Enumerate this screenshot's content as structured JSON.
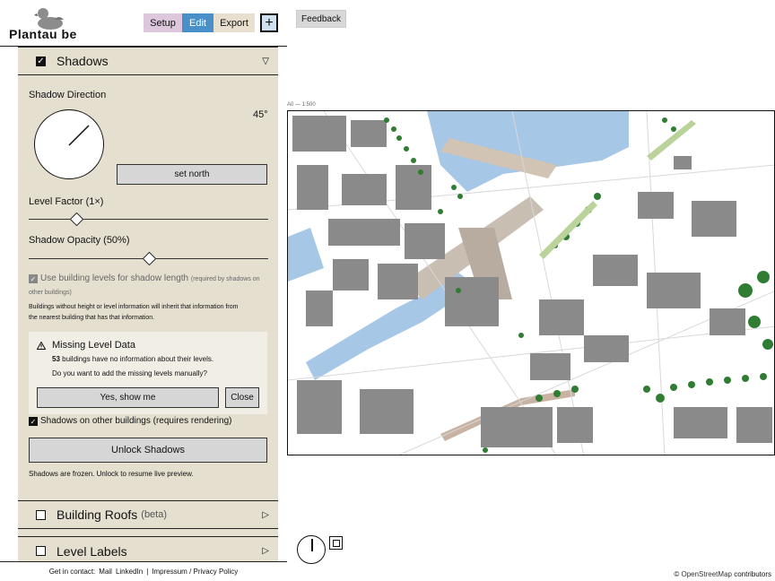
{
  "header": {
    "logo_text": "Plantau be",
    "tabs": [
      {
        "label": "Setup"
      },
      {
        "label": "Edit"
      },
      {
        "label": "Export"
      }
    ],
    "plus_label": "+",
    "feedback_label": "Feedback"
  },
  "shadows": {
    "title": "Shadows",
    "shadow_direction_label": "Shadow Direction",
    "direction_value": "45°",
    "set_north_label": "set north",
    "level_factor_label": "Level Factor (1×)",
    "level_factor_value": 0.2,
    "shadow_opacity_label": "Shadow Opacity (50%)",
    "shadow_opacity_value": 0.5,
    "use_levels_label": "Use building levels for shadow length",
    "use_levels_note": "(required by shadows on",
    "use_levels_note2": "other buildings)",
    "info_line1": "Buildings without height or level information will inherit that information from",
    "info_line2": "the nearest building that has that information.",
    "warning": {
      "title": "Missing Level Data",
      "count": "53",
      "line1_rest": " buildings have no information about their levels.",
      "line2": "Do you want to add the missing levels manually?",
      "yes_label": "Yes, show me",
      "close_label": "Close"
    },
    "other_buildings_label": "Shadows on other buildings (requires rendering)",
    "unlock_label": "Unlock Shadows",
    "frozen_note": "Shadows are frozen. Unlock to resume live preview."
  },
  "sections": [
    {
      "title": "Building Roofs",
      "badge": "(beta)"
    },
    {
      "title": "Level Labels"
    }
  ],
  "footer": {
    "contact": "Get in contact:",
    "mail": "Mail",
    "linkedin": "LinkedIn",
    "sep": "|",
    "impressum": "Impressum / Privacy Policy"
  },
  "map": {
    "scale_label": "A0 — 1:500",
    "attribution_prefix": "© ",
    "attribution_link": "OpenStreetMap",
    "attribution_suffix": " contributors"
  },
  "colors": {
    "sidebar_bg": "#e4dfcf",
    "edit_tab": "#4a90c8",
    "setup_tab": "#dcc7dc",
    "export_tab": "#e8dfcf",
    "water": "#a7c7e7",
    "building": "#8a8a8a",
    "shadow": "#cfcfcf",
    "tree": "#2f7d32"
  }
}
